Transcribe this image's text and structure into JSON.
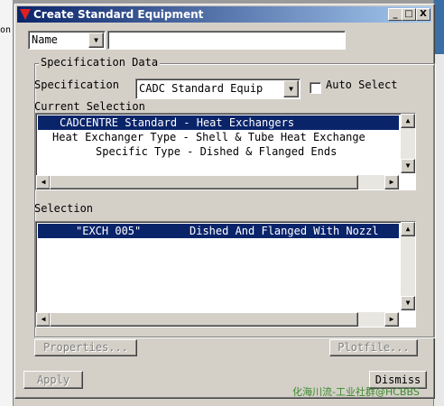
{
  "background": {
    "left_strip_text": "on"
  },
  "window": {
    "title": "Create Standard Equipment",
    "controls": {
      "minimize": "_",
      "maximize": "□",
      "close": "X"
    }
  },
  "name_row": {
    "selected": "Name",
    "input_value": ""
  },
  "spec_group": {
    "label": "Specification Data",
    "specification_label": "Specification",
    "specification_value": "CADC Standard Equip",
    "auto_select_label": "Auto Select",
    "auto_select_checked": false,
    "current_selection_label": "Current Selection",
    "current_selection": [
      {
        "text": "CADCENTRE Standard - Heat Exchangers",
        "selected": true
      },
      {
        "text": "Heat Exchanger Type - Shell & Tube Heat Exchange",
        "selected": false
      },
      {
        "text": "Specific Type - Dished & Flanged Ends",
        "selected": false
      }
    ],
    "selection_label": "Selection",
    "selection_items": [
      {
        "code": "\"EXCH 005\"",
        "description": "Dished And Flanged With Nozzl",
        "selected": true
      }
    ],
    "properties_button": "Properties...",
    "plotfile_button": "Plotfile..."
  },
  "footer": {
    "apply_button": "Apply",
    "dismiss_button": "Dismiss"
  },
  "watermark": "化海川流-工业社群@HCBBS",
  "colors": {
    "dialog_bg": "#d4d0c8",
    "selection_bg": "#0a246a",
    "titlebar_start": "#0a246a",
    "titlebar_end": "#a6caf0"
  }
}
